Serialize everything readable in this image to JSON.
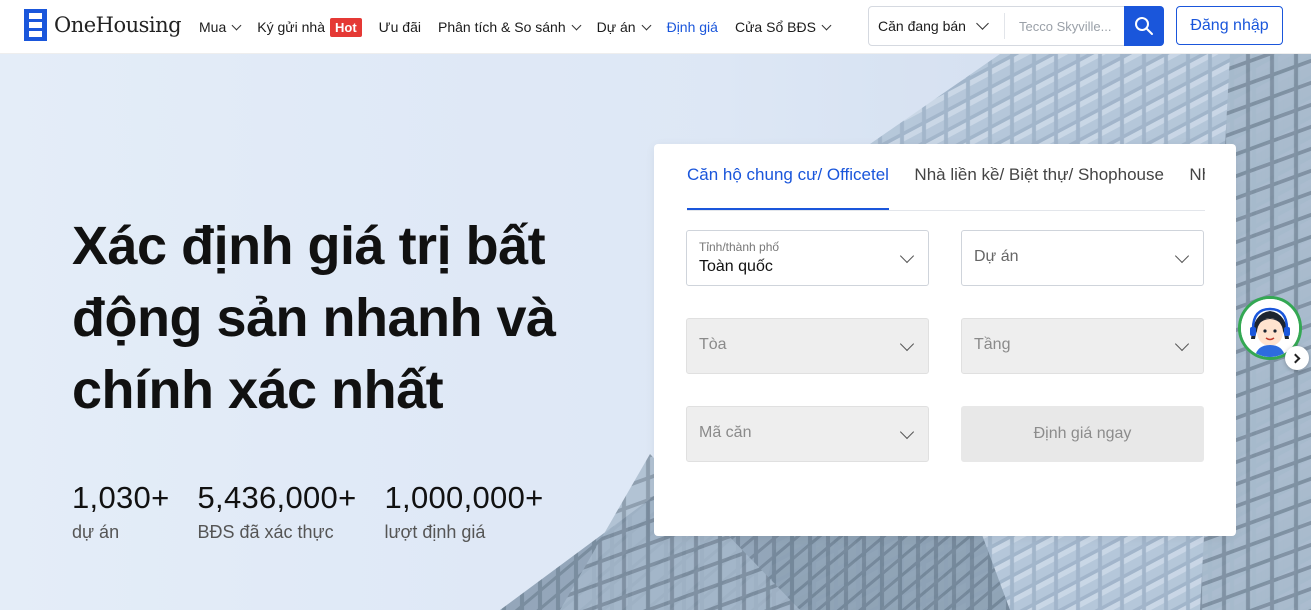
{
  "header": {
    "logo_text": "OneHousing",
    "nav": [
      {
        "label": "Mua",
        "dropdown": true
      },
      {
        "label": "Ký gửi nhà",
        "badge": "Hot"
      },
      {
        "label": "Ưu đãi"
      },
      {
        "label": "Phân tích & So sánh",
        "dropdown": true
      },
      {
        "label": "Dự án",
        "dropdown": true
      },
      {
        "label": "Định giá",
        "active": true
      },
      {
        "label": "Cửa Sổ BĐS",
        "dropdown": true
      }
    ],
    "search": {
      "type_value": "Căn đang bán",
      "placeholder": "Tecco Skyville..."
    },
    "login_label": "Đăng nhập"
  },
  "hero": {
    "title": "Xác định giá trị bất động sản nhanh và chính xác nhất",
    "stats": [
      {
        "value": "1,030+",
        "label": "dự án"
      },
      {
        "value": "5,436,000+",
        "label": "BĐS đã xác thực"
      },
      {
        "value": "1,000,000+",
        "label": "lượt định giá"
      }
    ]
  },
  "valuation_form": {
    "tabs": [
      "Căn hộ chung cư/ Officetel",
      "Nhà liền kề/ Biệt thự/ Shophouse",
      "Nhà riêng"
    ],
    "active_tab": 0,
    "fields": {
      "city": {
        "label": "Tỉnh/thành phố",
        "value": "Toàn quốc"
      },
      "project": {
        "placeholder": "Dự án"
      },
      "building": {
        "placeholder": "Tòa"
      },
      "floor": {
        "placeholder": "Tầng"
      },
      "unit": {
        "placeholder": "Mã căn"
      }
    },
    "submit_label": "Định giá ngay"
  },
  "colors": {
    "brand": "#1a56db",
    "hot_badge": "#e53935",
    "chat_ring": "#34a853"
  }
}
